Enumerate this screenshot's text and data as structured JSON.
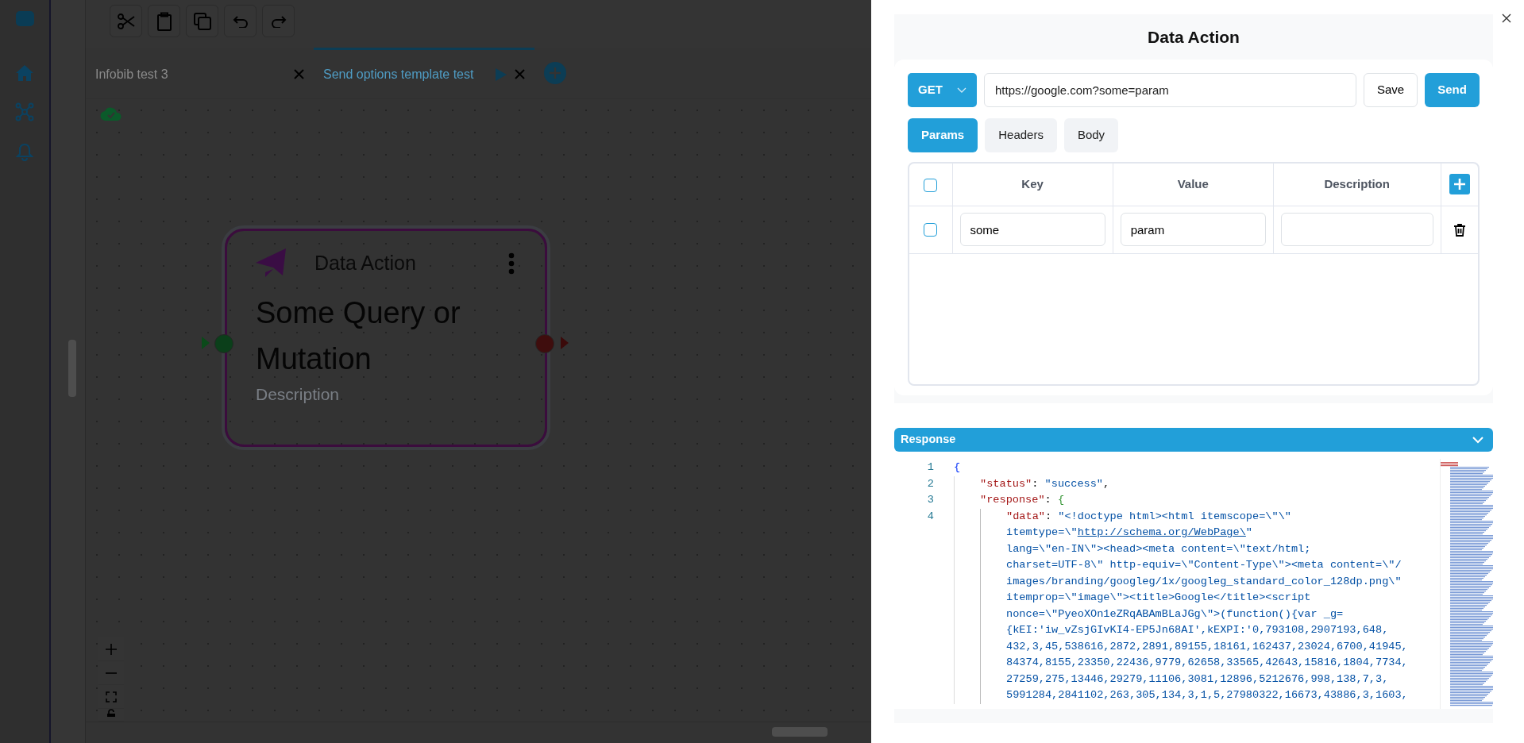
{
  "editor_tabs": [
    {
      "label": "Infobib test 3",
      "selected": false
    },
    {
      "label": "Send options template test",
      "selected": true
    }
  ],
  "node": {
    "type": "Data Action",
    "title": "Some Query or Mutation",
    "description": "Description"
  },
  "panel": {
    "title": "Data Action",
    "method": "GET",
    "url": "https://google.com?some=param",
    "buttons": [
      "Save",
      "Send"
    ],
    "tabs": [
      {
        "label": "Params",
        "selected": true
      },
      {
        "label": "Headers",
        "selected": false
      },
      {
        "label": "Body",
        "selected": false
      }
    ],
    "table": {
      "header_checked": false,
      "columns": [
        "Key",
        "Value",
        "Description"
      ],
      "rows": [
        {
          "checked": false,
          "key": "some",
          "value": "param"
        }
      ]
    }
  },
  "response": {
    "title": "Response",
    "expanded": true,
    "lines": [
      {
        "number": "1",
        "parts": [
          {
            "kind": "brace",
            "text": "{"
          }
        ],
        "children": [
          {
            "number": "2",
            "parts": [
              {
                "kind": "key",
                "text": "\"status\""
              },
              {
                "kind": "punct",
                "text": ": "
              },
              {
                "kind": "string",
                "text": "\"success\""
              },
              {
                "kind": "punct",
                "text": ","
              }
            ]
          },
          {
            "number": "3",
            "parts": [
              {
                "kind": "key",
                "text": "\"response\""
              },
              {
                "kind": "punct",
                "text": ": "
              },
              {
                "kind": "brace",
                "text": "{"
              }
            ],
            "children": [
              {
                "number": "4",
                "parts": [
                  {
                    "kind": "key",
                    "text": "\"data\""
                  },
                  {
                    "kind": "punct",
                    "text": ": "
                  },
                  {
                    "kind": "string",
                    "text": "\"<!doctype html><html itemscope=\\\"\\\""
                  }
                ],
                "wrapped": [
                  [
                    {
                      "kind": "string",
                      "text": "itemtype=\\\""
                    },
                    {
                      "kind": "link",
                      "text": "http://schema.org/WebPage\\"
                    },
                    {
                      "kind": "string",
                      "text": "\""
                    }
                  ],
                  [
                    {
                      "kind": "string",
                      "text": "lang=\\\"en-IN\\\"><head><meta content=\\\"text/html;"
                    }
                  ],
                  [
                    {
                      "kind": "string",
                      "text": "charset=UTF-8\\\" http-equiv=\\\"Content-Type\\\"><meta content=\\\"/"
                    }
                  ],
                  [
                    {
                      "kind": "string",
                      "text": "images/branding/googleg/1x/googleg_standard_color_128dp.png\\\""
                    }
                  ],
                  [
                    {
                      "kind": "string",
                      "text": "itemprop=\\\"image\\\"><title>Google</title><script"
                    }
                  ],
                  [
                    {
                      "kind": "string",
                      "text": "nonce=\\\"PyeoXOn1eZRqABAmBLaJGg\\\">(function(){var _g="
                    }
                  ],
                  [
                    {
                      "kind": "string",
                      "text": "{kEI:'iw_vZsjGIvKI4-EP5Jn68AI',kEXPI:'0,793108,2907193,648,"
                    }
                  ],
                  [
                    {
                      "kind": "string",
                      "text": "432,3,45,538616,2872,2891,89155,18161,162437,23024,6700,41945,"
                    }
                  ],
                  [
                    {
                      "kind": "string",
                      "text": "84374,8155,23350,22436,9779,62658,33565,42643,15816,1804,7734,"
                    }
                  ],
                  [
                    {
                      "kind": "string",
                      "text": "27259,275,13446,29279,11106,3081,12896,5212676,998,138,7,3,"
                    }
                  ],
                  [
                    {
                      "kind": "string",
                      "text": "5991284,2841102,263,305,134,3,1,5,27980322,16673,43886,3,1603,"
                    }
                  ]
                ]
              }
            ]
          }
        ]
      }
    ]
  }
}
